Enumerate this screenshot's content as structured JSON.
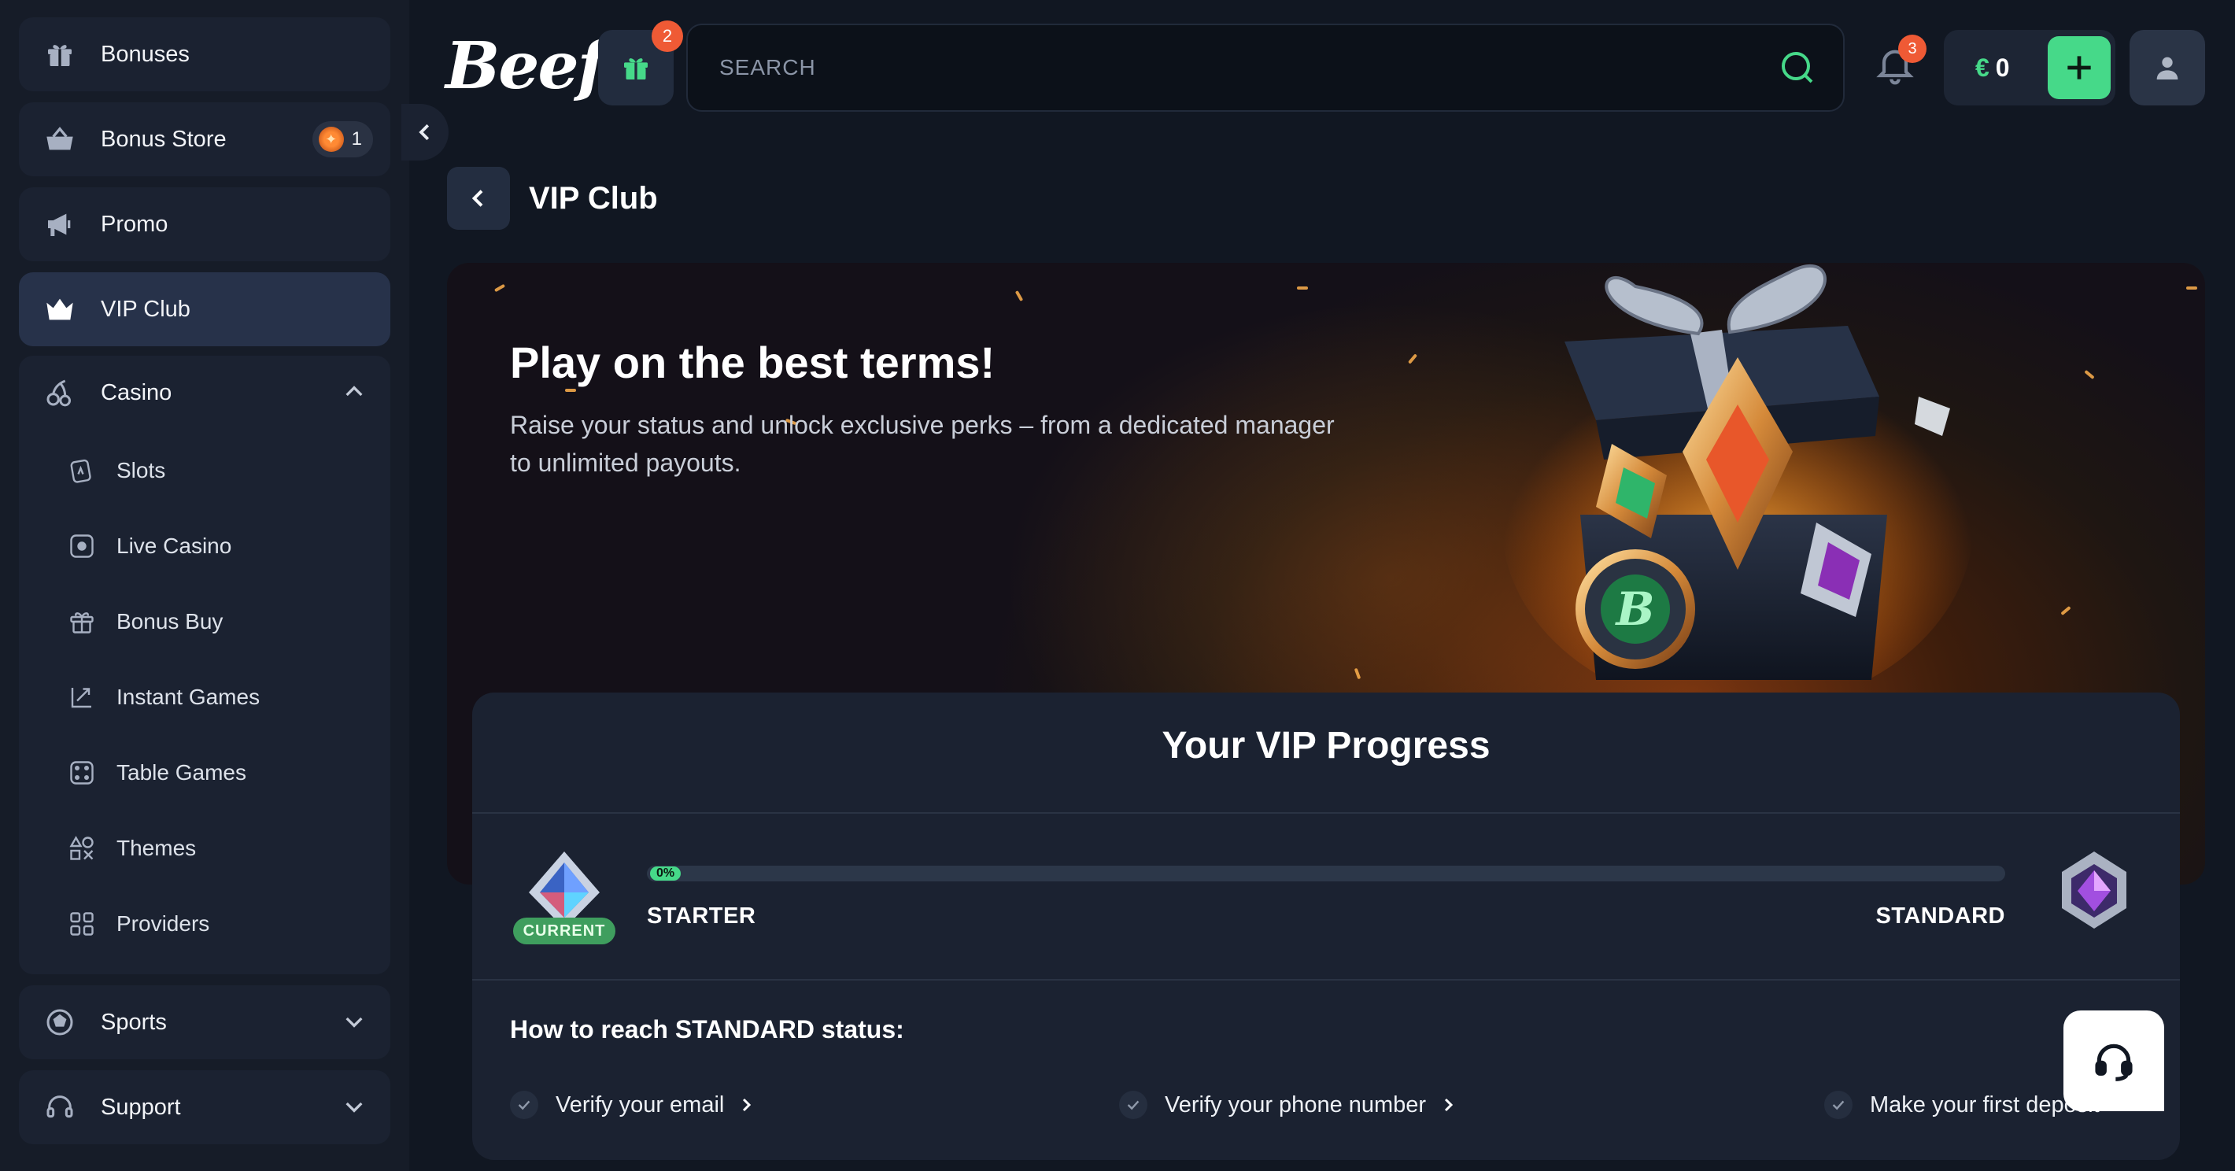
{
  "header": {
    "logo_text": "Beef",
    "gift_badge": "2",
    "search_placeholder": "SEARCH",
    "notifications_badge": "3",
    "balance_currency": "€",
    "balance_amount": "0"
  },
  "sidebar": {
    "items": [
      {
        "label": "Bonuses",
        "icon": "gift-icon"
      },
      {
        "label": "Bonus Store",
        "icon": "basket-icon",
        "badge": "1"
      },
      {
        "label": "Promo",
        "icon": "megaphone-icon"
      },
      {
        "label": "VIP Club",
        "icon": "crown-icon",
        "active": true
      }
    ],
    "casino": {
      "label": "Casino",
      "sub_items": [
        {
          "label": "Slots",
          "icon": "slots-icon"
        },
        {
          "label": "Live Casino",
          "icon": "live-casino-icon"
        },
        {
          "label": "Bonus Buy",
          "icon": "bonus-buy-icon"
        },
        {
          "label": "Instant Games",
          "icon": "instant-games-icon"
        },
        {
          "label": "Table Games",
          "icon": "dice-icon"
        },
        {
          "label": "Themes",
          "icon": "themes-icon"
        },
        {
          "label": "Providers",
          "icon": "providers-icon"
        }
      ]
    },
    "sports": {
      "label": "Sports"
    },
    "support": {
      "label": "Support"
    }
  },
  "page": {
    "title": "VIP Club"
  },
  "hero": {
    "title": "Play on the best terms!",
    "subtitle": "Raise your status and unlock exclusive perks – from a dedicated manager to unlimited payouts."
  },
  "progress": {
    "title": "Your VIP Progress",
    "current_badge": "CURRENT",
    "percent_label": "0%",
    "percent_value": 0.0,
    "from_level": "STARTER",
    "to_level": "STANDARD",
    "how_title": "How to reach STANDARD status:",
    "tasks": [
      {
        "label": "Verify your email"
      },
      {
        "label": "Verify your phone number"
      },
      {
        "label": "Make your first deposit"
      }
    ]
  },
  "colors": {
    "accent": "#46d989",
    "badge_red": "#ef5a35",
    "background": "#111722",
    "sidebar": "#161c28"
  }
}
